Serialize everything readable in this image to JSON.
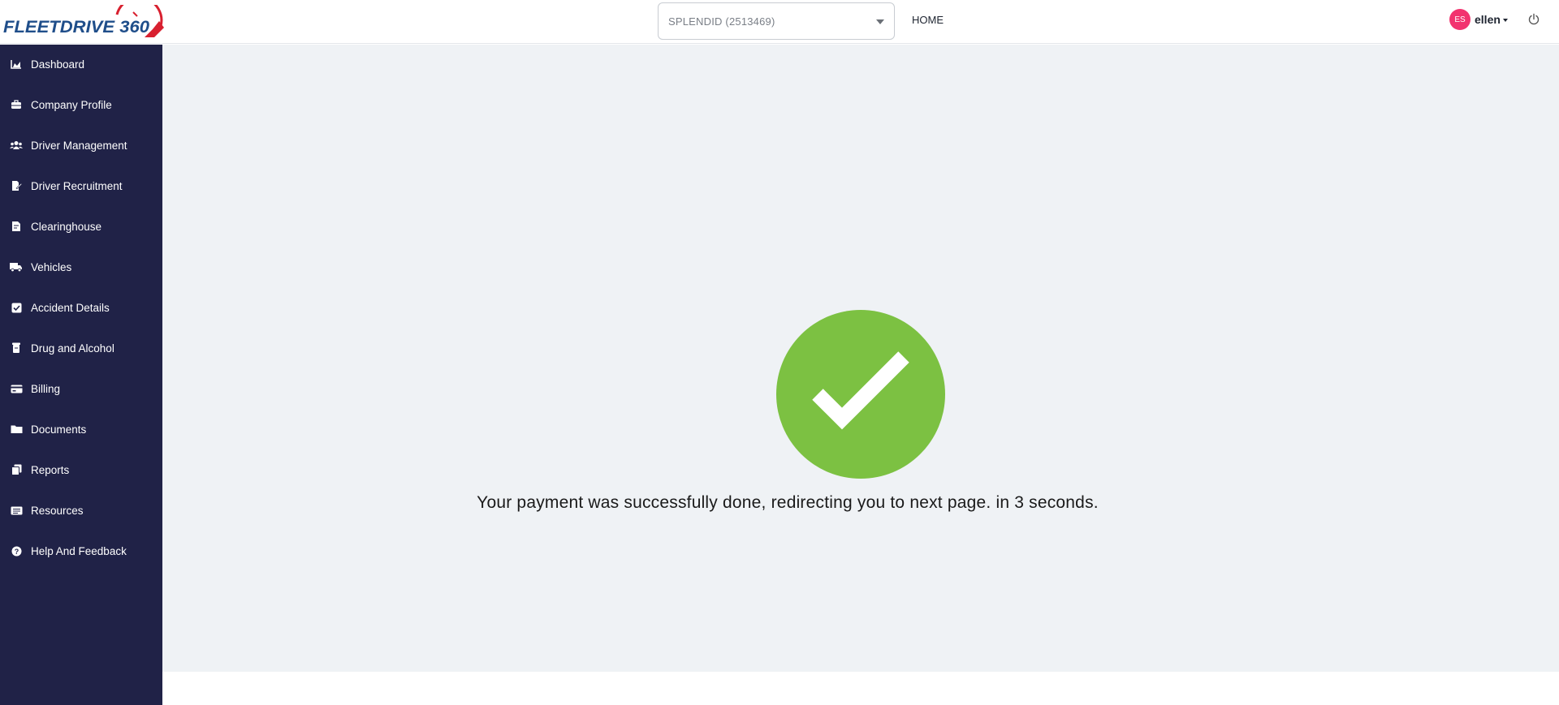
{
  "header": {
    "logo_text": "FLEETDRIVE 360",
    "company_select": {
      "value": "SPLENDID (2513469)"
    },
    "home_link": "HOME",
    "user": {
      "initials": "ES",
      "name": "ellen"
    }
  },
  "sidebar": {
    "items": [
      {
        "label": "Dashboard",
        "icon": "chart-area-icon"
      },
      {
        "label": "Company Profile",
        "icon": "briefcase-icon"
      },
      {
        "label": "Driver Management",
        "icon": "users-icon"
      },
      {
        "label": "Driver Recruitment",
        "icon": "signature-icon"
      },
      {
        "label": "Clearinghouse",
        "icon": "file-contract-icon"
      },
      {
        "label": "Vehicles",
        "icon": "truck-icon"
      },
      {
        "label": "Accident Details",
        "icon": "check-square-icon"
      },
      {
        "label": "Drug and Alcohol",
        "icon": "prescription-icon"
      },
      {
        "label": "Billing",
        "icon": "credit-card-icon"
      },
      {
        "label": "Documents",
        "icon": "folder-icon"
      },
      {
        "label": "Reports",
        "icon": "copy-icon"
      },
      {
        "label": "Resources",
        "icon": "newspaper-icon"
      },
      {
        "label": "Help And Feedback",
        "icon": "question-circle-icon"
      }
    ]
  },
  "main": {
    "message": "Your payment was successfully done, redirecting you to next page. in 3 seconds."
  },
  "colors": {
    "sidebar_bg": "#202247",
    "main_bg": "#eff2f5",
    "success_green": "#7cc142",
    "avatar_pink": "#f2336f",
    "logo_red": "#d8202f",
    "logo_blue": "#1f4e8a"
  }
}
